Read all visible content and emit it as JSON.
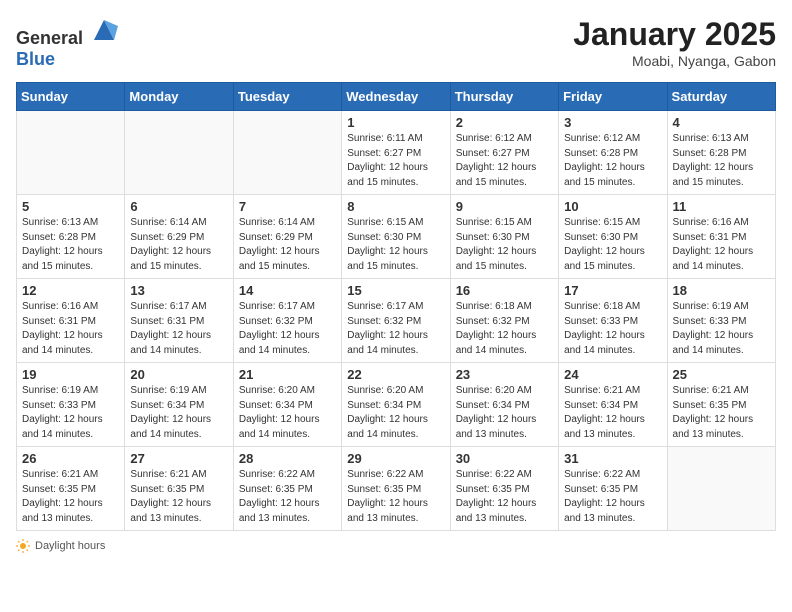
{
  "header": {
    "logo_general": "General",
    "logo_blue": "Blue",
    "title": "January 2025",
    "location": "Moabi, Nyanga, Gabon"
  },
  "days_of_week": [
    "Sunday",
    "Monday",
    "Tuesday",
    "Wednesday",
    "Thursday",
    "Friday",
    "Saturday"
  ],
  "weeks": [
    [
      {
        "day": "",
        "info": ""
      },
      {
        "day": "",
        "info": ""
      },
      {
        "day": "",
        "info": ""
      },
      {
        "day": "1",
        "info": "Sunrise: 6:11 AM\nSunset: 6:27 PM\nDaylight: 12 hours\nand 15 minutes."
      },
      {
        "day": "2",
        "info": "Sunrise: 6:12 AM\nSunset: 6:27 PM\nDaylight: 12 hours\nand 15 minutes."
      },
      {
        "day": "3",
        "info": "Sunrise: 6:12 AM\nSunset: 6:28 PM\nDaylight: 12 hours\nand 15 minutes."
      },
      {
        "day": "4",
        "info": "Sunrise: 6:13 AM\nSunset: 6:28 PM\nDaylight: 12 hours\nand 15 minutes."
      }
    ],
    [
      {
        "day": "5",
        "info": "Sunrise: 6:13 AM\nSunset: 6:28 PM\nDaylight: 12 hours\nand 15 minutes."
      },
      {
        "day": "6",
        "info": "Sunrise: 6:14 AM\nSunset: 6:29 PM\nDaylight: 12 hours\nand 15 minutes."
      },
      {
        "day": "7",
        "info": "Sunrise: 6:14 AM\nSunset: 6:29 PM\nDaylight: 12 hours\nand 15 minutes."
      },
      {
        "day": "8",
        "info": "Sunrise: 6:15 AM\nSunset: 6:30 PM\nDaylight: 12 hours\nand 15 minutes."
      },
      {
        "day": "9",
        "info": "Sunrise: 6:15 AM\nSunset: 6:30 PM\nDaylight: 12 hours\nand 15 minutes."
      },
      {
        "day": "10",
        "info": "Sunrise: 6:15 AM\nSunset: 6:30 PM\nDaylight: 12 hours\nand 15 minutes."
      },
      {
        "day": "11",
        "info": "Sunrise: 6:16 AM\nSunset: 6:31 PM\nDaylight: 12 hours\nand 14 minutes."
      }
    ],
    [
      {
        "day": "12",
        "info": "Sunrise: 6:16 AM\nSunset: 6:31 PM\nDaylight: 12 hours\nand 14 minutes."
      },
      {
        "day": "13",
        "info": "Sunrise: 6:17 AM\nSunset: 6:31 PM\nDaylight: 12 hours\nand 14 minutes."
      },
      {
        "day": "14",
        "info": "Sunrise: 6:17 AM\nSunset: 6:32 PM\nDaylight: 12 hours\nand 14 minutes."
      },
      {
        "day": "15",
        "info": "Sunrise: 6:17 AM\nSunset: 6:32 PM\nDaylight: 12 hours\nand 14 minutes."
      },
      {
        "day": "16",
        "info": "Sunrise: 6:18 AM\nSunset: 6:32 PM\nDaylight: 12 hours\nand 14 minutes."
      },
      {
        "day": "17",
        "info": "Sunrise: 6:18 AM\nSunset: 6:33 PM\nDaylight: 12 hours\nand 14 minutes."
      },
      {
        "day": "18",
        "info": "Sunrise: 6:19 AM\nSunset: 6:33 PM\nDaylight: 12 hours\nand 14 minutes."
      }
    ],
    [
      {
        "day": "19",
        "info": "Sunrise: 6:19 AM\nSunset: 6:33 PM\nDaylight: 12 hours\nand 14 minutes."
      },
      {
        "day": "20",
        "info": "Sunrise: 6:19 AM\nSunset: 6:34 PM\nDaylight: 12 hours\nand 14 minutes."
      },
      {
        "day": "21",
        "info": "Sunrise: 6:20 AM\nSunset: 6:34 PM\nDaylight: 12 hours\nand 14 minutes."
      },
      {
        "day": "22",
        "info": "Sunrise: 6:20 AM\nSunset: 6:34 PM\nDaylight: 12 hours\nand 14 minutes."
      },
      {
        "day": "23",
        "info": "Sunrise: 6:20 AM\nSunset: 6:34 PM\nDaylight: 12 hours\nand 13 minutes."
      },
      {
        "day": "24",
        "info": "Sunrise: 6:21 AM\nSunset: 6:34 PM\nDaylight: 12 hours\nand 13 minutes."
      },
      {
        "day": "25",
        "info": "Sunrise: 6:21 AM\nSunset: 6:35 PM\nDaylight: 12 hours\nand 13 minutes."
      }
    ],
    [
      {
        "day": "26",
        "info": "Sunrise: 6:21 AM\nSunset: 6:35 PM\nDaylight: 12 hours\nand 13 minutes."
      },
      {
        "day": "27",
        "info": "Sunrise: 6:21 AM\nSunset: 6:35 PM\nDaylight: 12 hours\nand 13 minutes."
      },
      {
        "day": "28",
        "info": "Sunrise: 6:22 AM\nSunset: 6:35 PM\nDaylight: 12 hours\nand 13 minutes."
      },
      {
        "day": "29",
        "info": "Sunrise: 6:22 AM\nSunset: 6:35 PM\nDaylight: 12 hours\nand 13 minutes."
      },
      {
        "day": "30",
        "info": "Sunrise: 6:22 AM\nSunset: 6:35 PM\nDaylight: 12 hours\nand 13 minutes."
      },
      {
        "day": "31",
        "info": "Sunrise: 6:22 AM\nSunset: 6:35 PM\nDaylight: 12 hours\nand 13 minutes."
      },
      {
        "day": "",
        "info": ""
      }
    ]
  ],
  "footer": {
    "daylight_label": "Daylight hours"
  }
}
